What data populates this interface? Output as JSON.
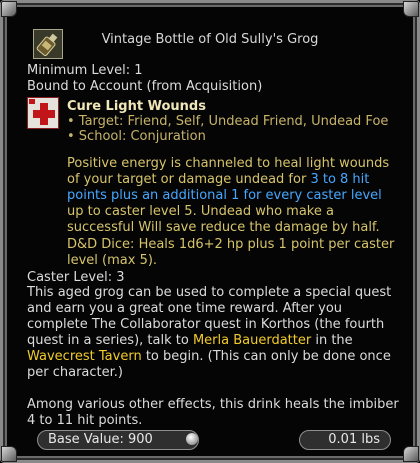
{
  "item": {
    "title": "Vintage Bottle of Old Sully's Grog",
    "icon": "grog-bottle-icon"
  },
  "requirements": {
    "minimum_level": "Minimum Level: 1",
    "binding": "Bound to Account (from Acquisition)"
  },
  "spell": {
    "icon": "cure-light-wounds-icon",
    "name": "Cure Light Wounds",
    "target": "• Target: Friend, Self, Undead Friend, Undead Foe",
    "school": "• School: Conjuration",
    "desc_part1": "Positive energy is channeled to heal light wounds of your target or damage undead for ",
    "desc_highlight": "3 to 8 hit points plus an additional 1 for every caster level",
    "desc_part2": " up to caster level 5. Undead who make a successful Will save reduce the damage by half.",
    "dice": "D&D Dice: Heals 1d6+2 hp plus 1 point per caster level (max 5)."
  },
  "caster_level": "Caster Level: 3",
  "flavor": {
    "part1": "This aged grog can be used to complete a special quest and earn you a great one time reward. After you complete The Collaborator quest in Korthos (the fourth quest in a series), talk to ",
    "npc": "Merla Bauerdatter",
    "part2": " in the ",
    "location": "Wavecrest Tavern",
    "part3": " to begin. (This can only be done once per character.)"
  },
  "effect": "Among various other effects, this drink heals the imbiber 4 to 11 hit points.",
  "footer": {
    "base_value": "Base Value: 900",
    "weight": "0.01 lbs",
    "coin_icon": "platinum-coin-icon"
  },
  "colors": {
    "highlight_blue": "#47a7ff",
    "highlight_gold": "#f2cc2b",
    "spell_text": "#d6c46c"
  }
}
